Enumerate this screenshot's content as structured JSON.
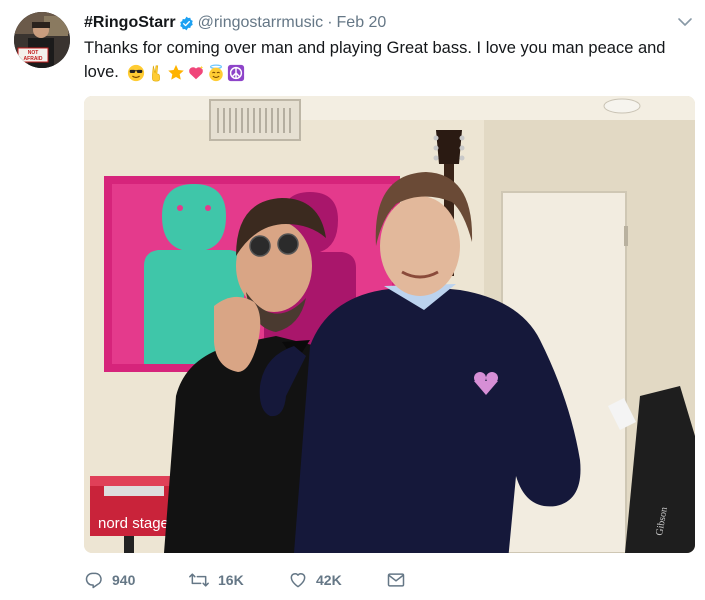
{
  "tweet": {
    "display_name": "#RingoStarr",
    "handle": "@ringostarrmusic",
    "separator": "·",
    "date": "Feb 20",
    "text": "Thanks for coming over man and playing  Great bass. I love you man peace and love.",
    "emojis": [
      "cool-face-emoji",
      "victory-hand-emoji",
      "star-emoji",
      "sparkling-heart-emoji",
      "halo-face-emoji",
      "peace-symbol-emoji"
    ],
    "avatar_sign_text": "NOT AFRAID",
    "photo_keyboard_text": "nord stage",
    "photo_guitar_text": "Gibson"
  },
  "actions": {
    "replies": "940",
    "retweets": "16K",
    "likes": "42K"
  },
  "colors": {
    "text": "#14171a",
    "secondary": "#657786",
    "verified": "#1da1f2",
    "painting_magenta": "#d6247b",
    "painting_turquoise": "#3fc6a9"
  }
}
